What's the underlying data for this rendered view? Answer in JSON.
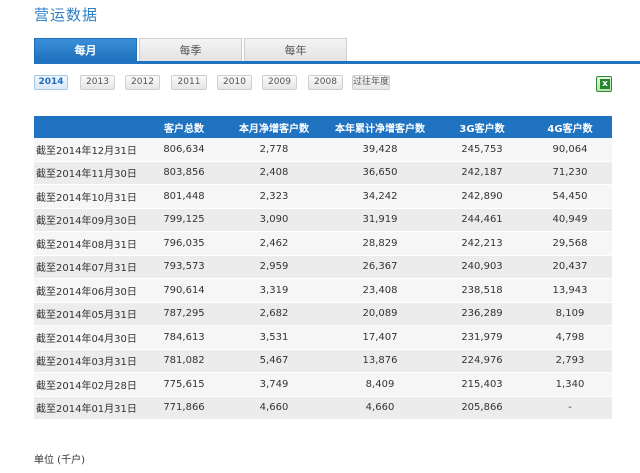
{
  "page_title": "营运数据",
  "tabs": [
    {
      "label": "每月",
      "active": true
    },
    {
      "label": "每季",
      "active": false
    },
    {
      "label": "每年",
      "active": false
    }
  ],
  "years": [
    {
      "label": "2014",
      "active": true
    },
    {
      "label": "2013",
      "active": false
    },
    {
      "label": "2012",
      "active": false
    },
    {
      "label": "2011",
      "active": false
    },
    {
      "label": "2010",
      "active": false
    },
    {
      "label": "2009",
      "active": false
    },
    {
      "label": "2008",
      "active": false
    },
    {
      "label": "过往年度",
      "active": false
    }
  ],
  "export_icon": "excel-icon",
  "table": {
    "headers": [
      "",
      "客户总数",
      "本月净增客户数",
      "本年累计净增客户数",
      "3G客户数",
      "4G客户数"
    ],
    "rows": [
      [
        "截至2014年12月31日",
        "806,634",
        "2,778",
        "39,428",
        "245,753",
        "90,064"
      ],
      [
        "截至2014年11月30日",
        "803,856",
        "2,408",
        "36,650",
        "242,187",
        "71,230"
      ],
      [
        "截至2014年10月31日",
        "801,448",
        "2,323",
        "34,242",
        "242,890",
        "54,450"
      ],
      [
        "截至2014年09月30日",
        "799,125",
        "3,090",
        "31,919",
        "244,461",
        "40,949"
      ],
      [
        "截至2014年08月31日",
        "796,035",
        "2,462",
        "28,829",
        "242,213",
        "29,568"
      ],
      [
        "截至2014年07月31日",
        "793,573",
        "2,959",
        "26,367",
        "240,903",
        "20,437"
      ],
      [
        "截至2014年06月30日",
        "790,614",
        "3,319",
        "23,408",
        "238,518",
        "13,943"
      ],
      [
        "截至2014年05月31日",
        "787,295",
        "2,682",
        "20,089",
        "236,289",
        "8,109"
      ],
      [
        "截至2014年04月30日",
        "784,613",
        "3,531",
        "17,407",
        "231,979",
        "4,798"
      ],
      [
        "截至2014年03月31日",
        "781,082",
        "5,467",
        "13,876",
        "224,976",
        "2,793"
      ],
      [
        "截至2014年02月28日",
        "775,615",
        "3,749",
        "8,409",
        "215,403",
        "1,340"
      ],
      [
        "截至2014年01月31日",
        "771,866",
        "4,660",
        "4,660",
        "205,866",
        "-"
      ]
    ]
  },
  "unit_note": "单位 (千户)",
  "colors": {
    "accent": "#1f73c0",
    "title": "#2f7fc6"
  }
}
